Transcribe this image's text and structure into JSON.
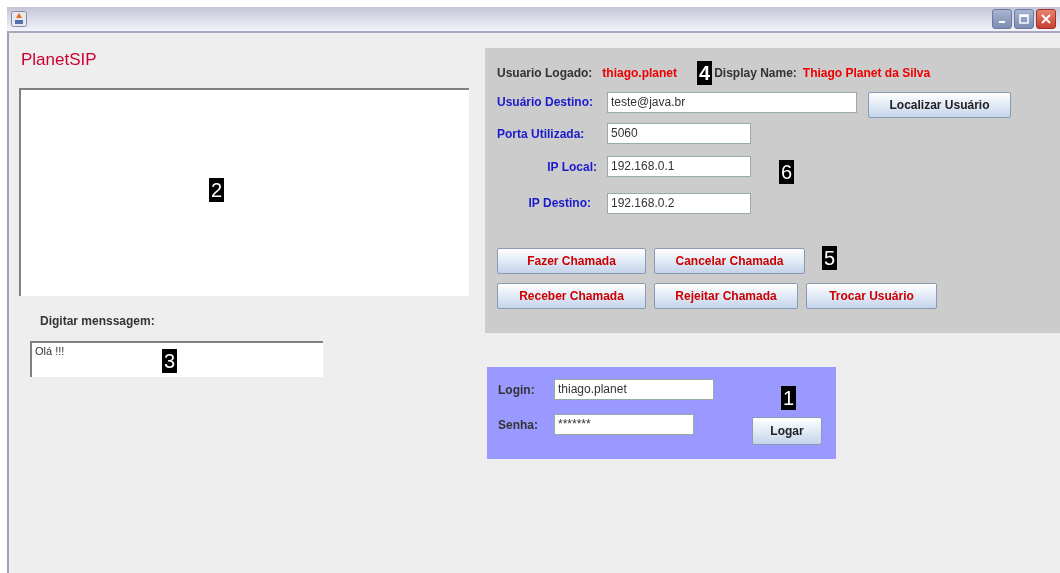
{
  "app_title": "PlanetSIP",
  "message": {
    "label": "Digitar menssagem:",
    "value": "Olá !!!",
    "callout": "3"
  },
  "chat": {
    "callout": "2"
  },
  "session": {
    "logged_user_label": "Usuario Logado:",
    "logged_user": "thiago.planet",
    "callout": "4",
    "display_name_label": "Display Name:",
    "display_name": "Thiago Planet da Silva"
  },
  "fields": [
    {
      "label": "Usuário Destino:",
      "value": "teste@java.br"
    },
    {
      "label": "Porta Utilizada:",
      "value": "5060"
    },
    {
      "label": "IP Local:",
      "value": "192.168.0.1"
    },
    {
      "label": "IP Destino:",
      "value": "192.168.0.2"
    }
  ],
  "fields_callout": "6",
  "find_button": "Localizar Usuário",
  "call_buttons": [
    [
      "Fazer Chamada",
      "Cancelar Chamada"
    ],
    [
      "Receber Chamada",
      "Rejeitar Chamada",
      "Trocar Usuário"
    ]
  ],
  "call_buttons_callout": "5",
  "login": {
    "fields": [
      {
        "label": "Login:",
        "value": "thiago.planet"
      },
      {
        "label": "Senha:",
        "value": "*******"
      }
    ],
    "button": "Logar",
    "callout": "1"
  }
}
